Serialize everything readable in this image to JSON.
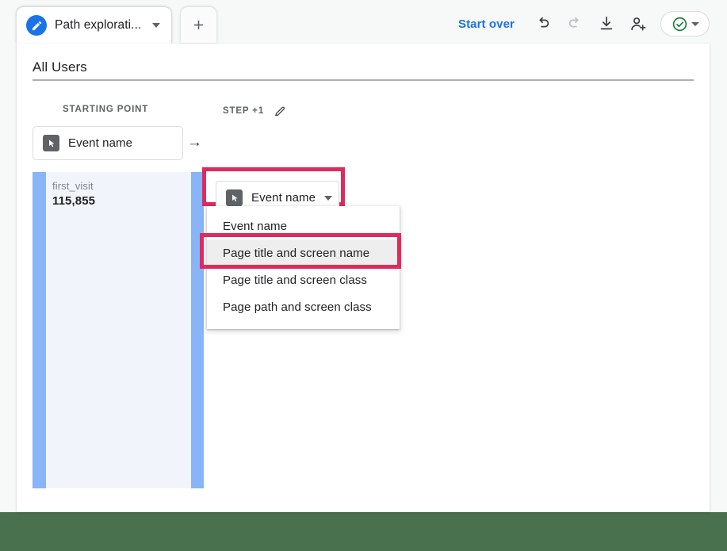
{
  "tab": {
    "title": "Path explorati...",
    "icon": "pencil-circle-icon",
    "caret": "chevron-down-icon",
    "add_label": "+",
    "add_icon": "plus-icon"
  },
  "toolbar": {
    "start_over": "Start over",
    "undo_icon": "undo-icon",
    "redo_icon": "redo-icon",
    "download_icon": "download-icon",
    "share_icon": "person-add-icon",
    "status_icon": "check-circle-icon",
    "status_caret": "chevron-down-icon",
    "accent_color": "#1a73e8",
    "status_color": "#188038"
  },
  "card": {
    "title": "All Users"
  },
  "steps": [
    {
      "header": "STARTING POINT",
      "chip_label": "Event name",
      "chip_icon": "cursor-icon",
      "has_caret": false,
      "has_edit": false
    },
    {
      "header": "STEP +1",
      "chip_label": "Event name",
      "chip_icon": "cursor-icon",
      "has_caret": true,
      "has_edit": true,
      "edit_icon": "pencil-icon",
      "arrow_icon": "arrow-right-icon"
    }
  ],
  "dropdown": {
    "open": true,
    "items": [
      {
        "label": "Event name",
        "selected": false
      },
      {
        "label": "Page title and screen name",
        "selected": true
      },
      {
        "label": "Page title and screen class",
        "selected": false
      },
      {
        "label": "Page path and screen class",
        "selected": false
      }
    ]
  },
  "highlights": {
    "color": "#e02a5b",
    "targets": [
      "step-1-dimension-chip",
      "menu-item-page-title-and-screen-name"
    ]
  },
  "chart_data": {
    "type": "sankey",
    "title": "All Users",
    "columns": [
      "STARTING POINT",
      "STEP +1"
    ],
    "nodes": [
      {
        "column": 0,
        "label": "first_visit",
        "value": 115855,
        "value_formatted": "115,855",
        "color": "#8ab4f8"
      },
      {
        "column": 1,
        "label": "",
        "value": 115855,
        "value_formatted": "",
        "color": "#8ab4f8"
      }
    ],
    "links": [
      {
        "source": "first_visit",
        "target": "",
        "value": 115855,
        "color": "#f1f4fb"
      }
    ],
    "node_color": "#8ab4f8",
    "link_color": "#f1f4fb"
  },
  "theme": {
    "page_background": "#f7f8f8",
    "card_background": "#ffffff",
    "footer_band": "#4a714e",
    "node_blue": "#8ab4f8",
    "flow_blue": "#f1f4fb"
  }
}
